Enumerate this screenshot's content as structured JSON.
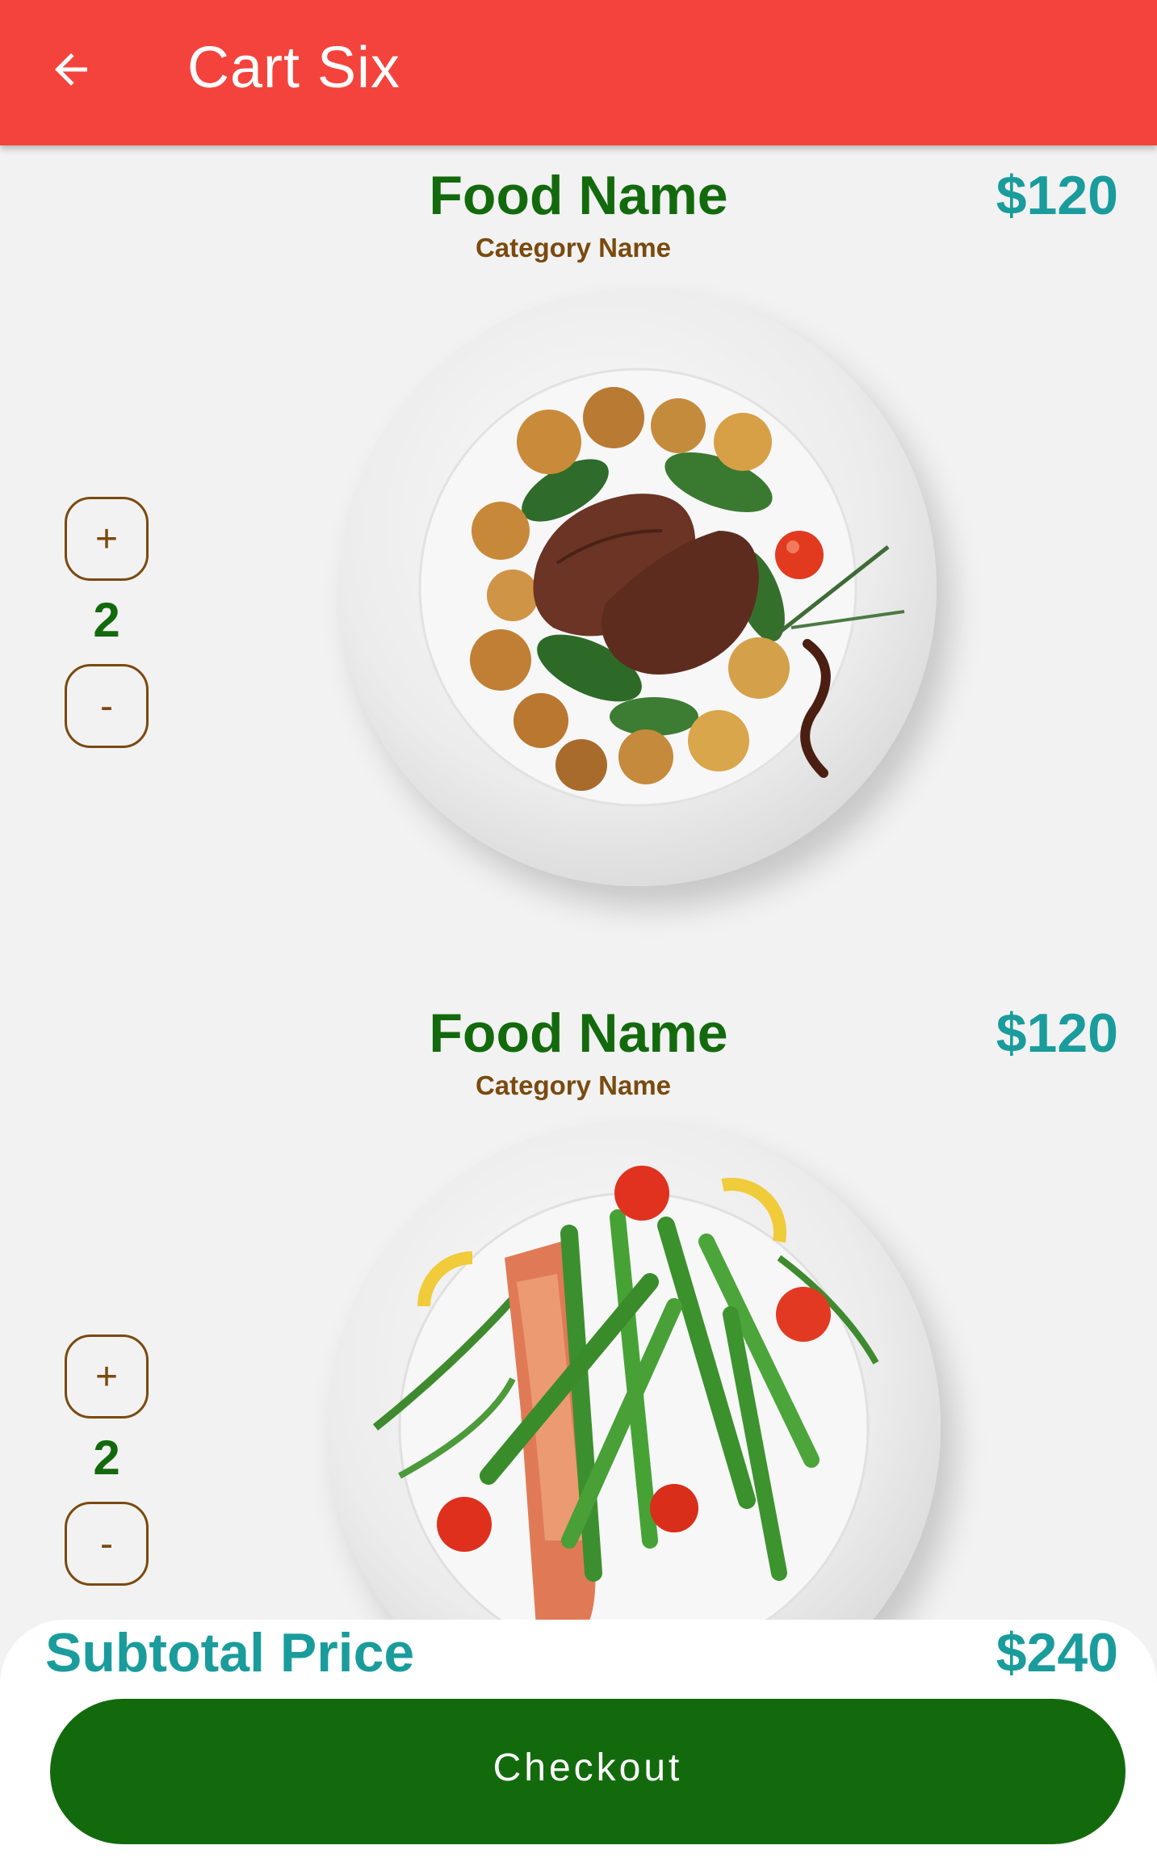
{
  "app_bar": {
    "title": "Cart Six",
    "back_icon": "arrow-left-icon",
    "color": "#f4433c"
  },
  "cart": {
    "items": [
      {
        "name": "Food Name",
        "category": "Category Name",
        "price": "$120",
        "quantity": "2",
        "increment_label": "+",
        "decrement_label": "-",
        "image": "steak-potatoes-plate"
      },
      {
        "name": "Food Name",
        "category": "Category Name",
        "price": "$120",
        "quantity": "2",
        "increment_label": "+",
        "decrement_label": "-",
        "image": "salmon-asparagus-plate"
      }
    ]
  },
  "summary": {
    "subtotal_label": "Subtotal Price",
    "subtotal_value": "$240",
    "checkout_label": "Checkout"
  },
  "colors": {
    "name": "#136a0d",
    "category": "#7a4a0f",
    "price": "#1a9c9c",
    "checkout": "#136a0d"
  }
}
